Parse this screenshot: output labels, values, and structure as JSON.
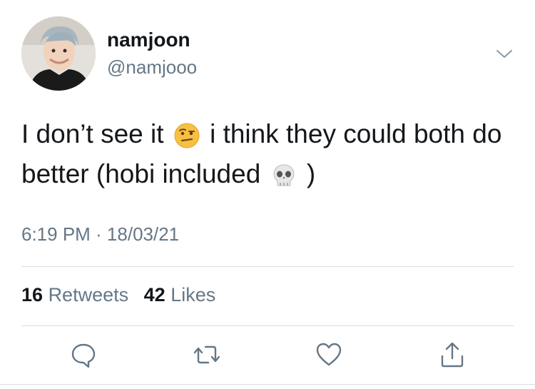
{
  "user": {
    "display_name": "namjoon",
    "handle": "@namjooo"
  },
  "tweet": {
    "text_part1": "I don’t see it",
    "emoji1": "face-with-raised-eyebrow-emoji",
    "text_part2": "i think they could both do better (hobi included",
    "emoji2": "skull-emoji",
    "text_part3": ")"
  },
  "timestamp": "6:19 PM · 18/03/21",
  "stats": {
    "retweets_count": "16",
    "retweets_label": "Retweets",
    "likes_count": "42",
    "likes_label": "Likes"
  },
  "actions": [
    "reply-icon",
    "retweet-icon",
    "like-icon",
    "share-icon"
  ],
  "colors": {
    "text": "#14171a",
    "secondary": "#657786",
    "divider": "#d8dde1"
  }
}
